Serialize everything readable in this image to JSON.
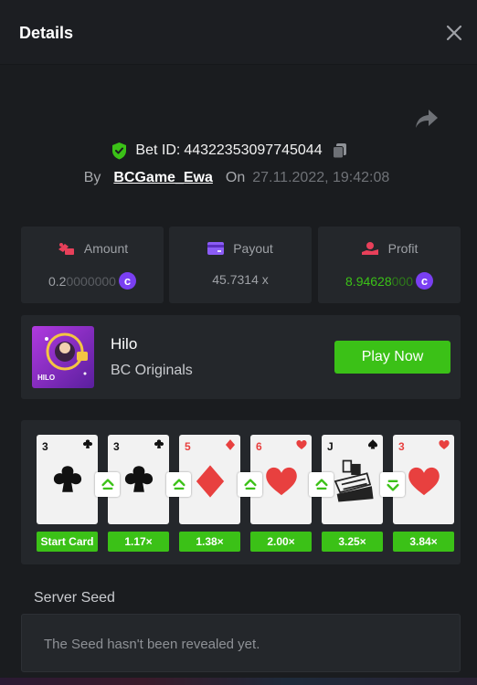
{
  "header": {
    "title": "Details",
    "close_icon": "close-icon"
  },
  "bet": {
    "id_label": "Bet ID:",
    "id_value": "44322353097745044",
    "by_label": "By",
    "username": "BCGame_Ewa",
    "on_label": "On",
    "date": "27.11.2022, 19:42:08"
  },
  "stats": {
    "amount": {
      "label": "Amount",
      "value_main": "0.2",
      "value_dim": "0000000",
      "coin": "c"
    },
    "payout": {
      "label": "Payout",
      "value": "45.7314 x"
    },
    "profit": {
      "label": "Profit",
      "value_main": "8.94628",
      "value_dim": "000",
      "coin": "c"
    }
  },
  "game": {
    "name": "Hilo",
    "provider": "BC Originals",
    "play_label": "Play Now",
    "thumb_label": "HILO"
  },
  "cards": [
    {
      "rank": "3",
      "suit": "clubs",
      "color": "#111111",
      "multiplier": "Start Card"
    },
    {
      "rank": "3",
      "suit": "clubs",
      "color": "#111111",
      "multiplier": "1.17×"
    },
    {
      "rank": "5",
      "suit": "diamonds",
      "color": "#e8403f",
      "multiplier": "1.38×"
    },
    {
      "rank": "6",
      "suit": "hearts",
      "color": "#e8403f",
      "multiplier": "2.00×"
    },
    {
      "rank": "J",
      "suit": "spades",
      "color": "#111111",
      "multiplier": "3.25×"
    },
    {
      "rank": "3",
      "suit": "hearts",
      "color": "#e8403f",
      "multiplier": "3.84×"
    }
  ],
  "arrows": [
    "up",
    "up",
    "up",
    "up",
    "down"
  ],
  "server": {
    "title": "Server Seed",
    "message": "The Seed hasn't been revealed yet."
  },
  "colors": {
    "accent_green": "#3bc117",
    "coin_purple": "#7a3ff2",
    "panel": "#24272b",
    "background": "#1a1c1f"
  }
}
